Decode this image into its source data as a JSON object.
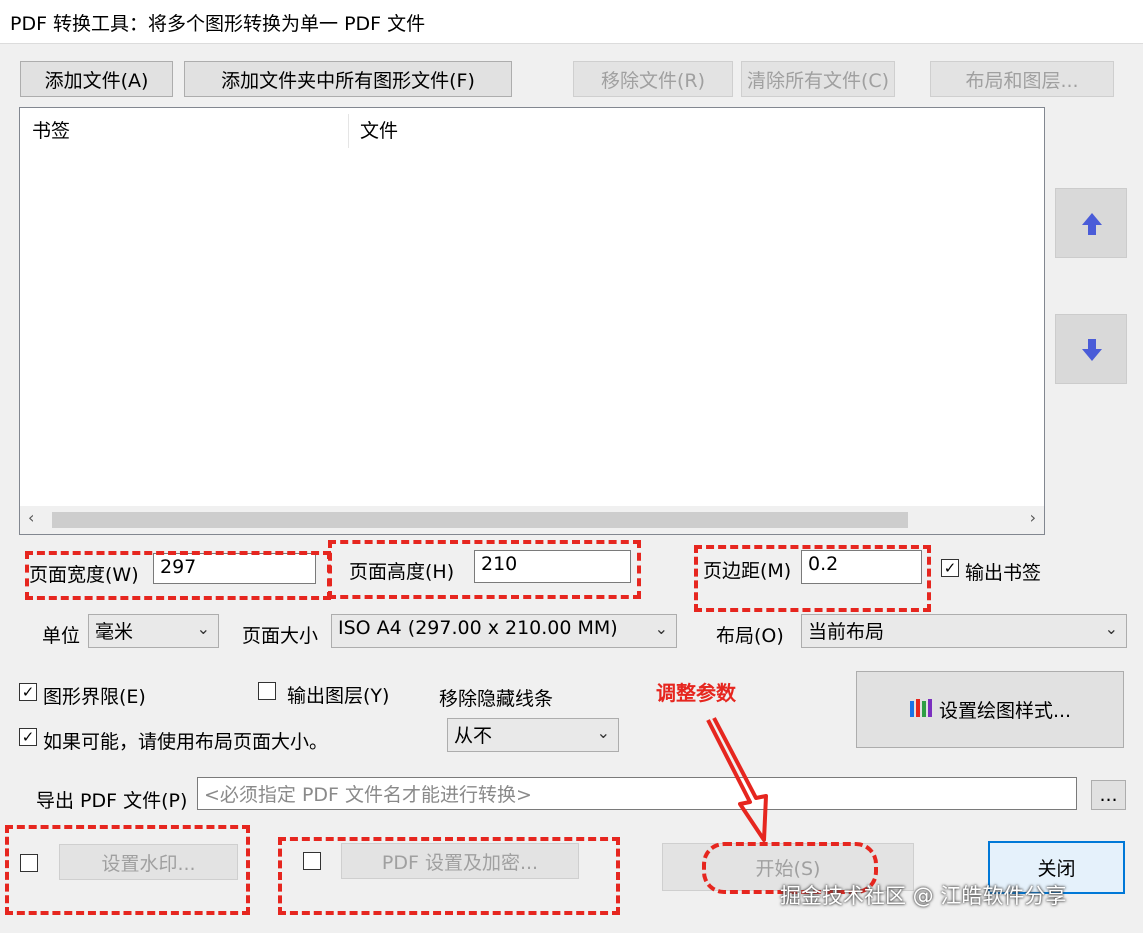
{
  "window": {
    "title": "PDF 转换工具：将多个图形转换为单一 PDF 文件"
  },
  "toolbar": {
    "add_file": "添加文件(A)",
    "add_folder": "添加文件夹中所有图形文件(F)",
    "remove_file": "移除文件(R)",
    "clear_all": "清除所有文件(C)",
    "layouts": "布局和图层..."
  },
  "list": {
    "columns": [
      "书签",
      "文件"
    ],
    "scroll_left": "‹",
    "scroll_right": "›"
  },
  "move": {
    "up": "⬆",
    "down": "⬇"
  },
  "page": {
    "width_label": "页面宽度(W)",
    "width_value": "297",
    "height_label": "页面高度(H)",
    "height_value": "210",
    "margin_label": "页边距(M)",
    "margin_value": "0.2",
    "bookmarks_label": "输出书签",
    "bookmarks_checked": "☑"
  },
  "units": {
    "label": "单位",
    "value": "毫米",
    "size_label": "页面大小",
    "size_value": "ISO A4 (297.00 x 210.00 MM)",
    "layout_label": "布局(O)",
    "layout_value": "当前布局",
    "chevron": "⌄"
  },
  "options": {
    "extents_label": "图形界限(E)",
    "layers_label": "输出图层(Y)",
    "hidden_label": "移除隐藏线条",
    "hidden_value": "从不",
    "layout_size_label": "如果可能，请使用布局页面大小。",
    "check_mark": "✓",
    "plot_style": "设置绘图样式..."
  },
  "export": {
    "label": "导出 PDF 文件(P)",
    "placeholder": "<必须指定 PDF 文件名才能进行转换>",
    "browse": "..."
  },
  "bottom": {
    "watermark": "设置水印...",
    "security": "PDF 设置及加密...",
    "start": "开始(S)",
    "close": "关闭"
  },
  "annotation": {
    "text": "调整参数"
  },
  "watermark": {
    "text": "掘金技术社区 @ 江皓软件分享"
  },
  "colors": {
    "accent": "#0078d7",
    "annotation_red": "#e6261f",
    "arrow_blue": "#4a5cd8"
  }
}
